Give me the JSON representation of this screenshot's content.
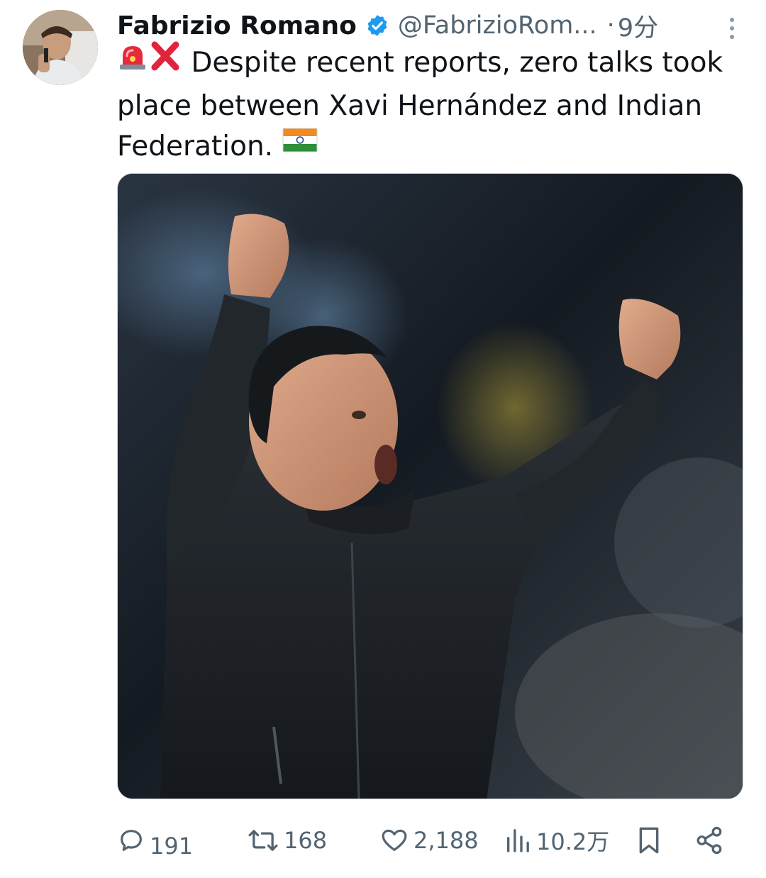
{
  "tweet": {
    "author_name": "Fabrizio Romano",
    "handle": "@FabrizioRom...",
    "separator": "·",
    "time": "9分",
    "text_lines": [
      "Despite recent reports, zero talks took",
      "place between Xavi Hernández and Indian",
      "Federation."
    ],
    "leading_emojis": [
      "rotating-light-icon",
      "cross-mark-icon"
    ],
    "trailing_emoji": "india-flag-icon"
  },
  "actions": {
    "replies": "191",
    "retweets": "168",
    "likes": "2,188",
    "views": "10.2万"
  },
  "colors": {
    "text": "#0f1419",
    "secondary": "#536471",
    "verified": "#1d9bf0"
  }
}
